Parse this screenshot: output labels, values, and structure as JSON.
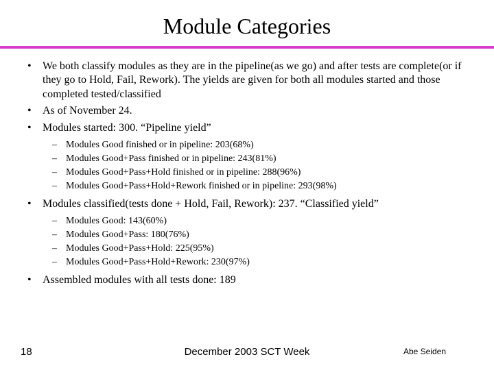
{
  "title": "Module Categories",
  "bullets": {
    "b1": "We both classify modules as they are in the pipeline(as we go) and after tests are complete(or if they go to Hold, Fail, Rework). The yields are given for both all modules started and those completed tested/classified",
    "b2": "As of November 24.",
    "b3": "Modules started: 300. “Pipeline yield”",
    "b3_sub": {
      "s1": "Modules Good finished or in pipeline: 203(68%)",
      "s2": "Modules Good+Pass finished or in pipeline: 243(81%)",
      "s3": "Modules Good+Pass+Hold finished or in pipeline: 288(96%)",
      "s4": "Modules Good+Pass+Hold+Rework finished or in pipeline: 293(98%)"
    },
    "b4": "Modules classified(tests done + Hold, Fail, Rework): 237. “Classified yield”",
    "b4_sub": {
      "s1": "Modules Good: 143(60%)",
      "s2": "Modules Good+Pass: 180(76%)",
      "s3": "Modules Good+Pass+Hold: 225(95%)",
      "s4": "Modules Good+Pass+Hold+Rework: 230(97%)"
    },
    "b5": "Assembled modules with all tests done: 189"
  },
  "footer": {
    "page": "18",
    "center": "December 2003 SCT Week",
    "author": "Abe Seiden"
  }
}
